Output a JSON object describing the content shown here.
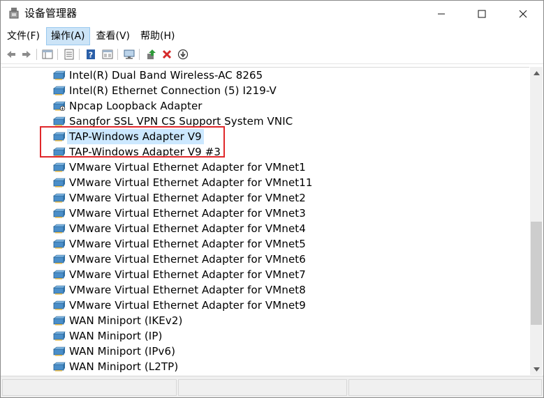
{
  "window": {
    "title": "设备管理器",
    "icon": "device-manager-icon",
    "controls": {
      "minimize": "–",
      "maximize": "☐",
      "close": "✕"
    }
  },
  "menu": {
    "items": [
      "文件(F)",
      "操作(A)",
      "查看(V)",
      "帮助(H)"
    ],
    "active_index": 1
  },
  "toolbar": {
    "icons": [
      "back-arrow-icon",
      "forward-arrow-icon",
      "properties-grid-icon",
      "show-hide-tree-icon",
      "help-icon",
      "update-driver-icon",
      "scan-hardware-icon",
      "enable-device-icon",
      "uninstall-icon",
      "disable-device-icon"
    ]
  },
  "tree": {
    "items": [
      {
        "label": "Intel(R) Dual Band Wireless-AC 8265",
        "icon": "network-adapter-icon"
      },
      {
        "label": "Intel(R) Ethernet Connection (5) I219-V",
        "icon": "network-adapter-icon"
      },
      {
        "label": "Npcap Loopback Adapter",
        "icon": "network-adapter-disabled-icon"
      },
      {
        "label": "Sangfor SSL VPN CS Support System VNIC",
        "icon": "network-adapter-icon"
      },
      {
        "label": "TAP-Windows Adapter V9",
        "icon": "network-adapter-icon",
        "selected": true
      },
      {
        "label": "TAP-Windows Adapter V9 #3",
        "icon": "network-adapter-icon"
      },
      {
        "label": "VMware Virtual Ethernet Adapter for VMnet1",
        "icon": "network-adapter-icon"
      },
      {
        "label": "VMware Virtual Ethernet Adapter for VMnet11",
        "icon": "network-adapter-icon"
      },
      {
        "label": "VMware Virtual Ethernet Adapter for VMnet2",
        "icon": "network-adapter-icon"
      },
      {
        "label": "VMware Virtual Ethernet Adapter for VMnet3",
        "icon": "network-adapter-icon"
      },
      {
        "label": "VMware Virtual Ethernet Adapter for VMnet4",
        "icon": "network-adapter-icon"
      },
      {
        "label": "VMware Virtual Ethernet Adapter for VMnet5",
        "icon": "network-adapter-icon"
      },
      {
        "label": "VMware Virtual Ethernet Adapter for VMnet6",
        "icon": "network-adapter-icon"
      },
      {
        "label": "VMware Virtual Ethernet Adapter for VMnet7",
        "icon": "network-adapter-icon"
      },
      {
        "label": "VMware Virtual Ethernet Adapter for VMnet8",
        "icon": "network-adapter-icon"
      },
      {
        "label": "VMware Virtual Ethernet Adapter for VMnet9",
        "icon": "network-adapter-icon"
      },
      {
        "label": "WAN Miniport (IKEv2)",
        "icon": "network-adapter-icon"
      },
      {
        "label": "WAN Miniport (IP)",
        "icon": "network-adapter-icon"
      },
      {
        "label": "WAN Miniport (IPv6)",
        "icon": "network-adapter-icon"
      },
      {
        "label": "WAN Miniport (L2TP)",
        "icon": "network-adapter-icon"
      }
    ]
  },
  "colors": {
    "selection": "#cce8ff",
    "highlight_box": "#e0272a",
    "delete_red": "#d62a2a"
  }
}
